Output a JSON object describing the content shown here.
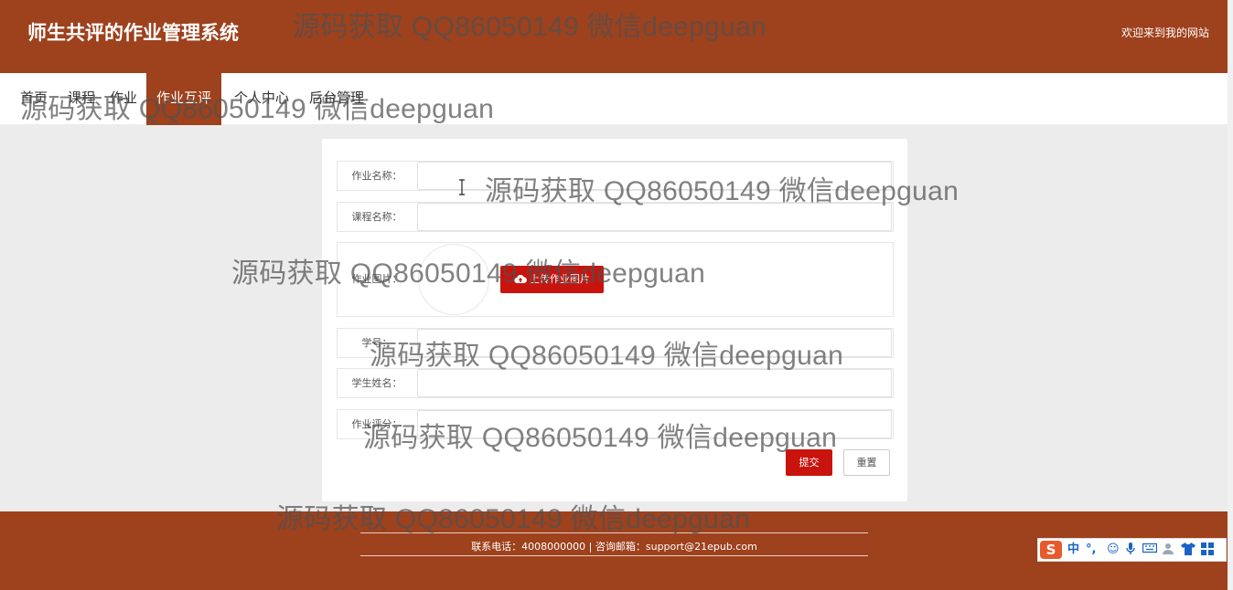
{
  "header": {
    "title": "师生共评的作业管理系统",
    "welcome": "欢迎来到我的网站"
  },
  "nav": {
    "items": [
      {
        "label": "首页"
      },
      {
        "label": "课程"
      },
      {
        "label": "作业"
      },
      {
        "label": "作业互评",
        "active": true
      },
      {
        "label": "个人中心"
      },
      {
        "label": "后台管理"
      }
    ]
  },
  "form": {
    "fields": [
      {
        "label": "作业名称：",
        "value": ""
      },
      {
        "label": "课程名称：",
        "value": ""
      },
      {
        "label": "作业图片：",
        "upload_label": "上传作业图片"
      },
      {
        "label": "学号：",
        "value": ""
      },
      {
        "label": "学生姓名：",
        "value": ""
      },
      {
        "label": "作业评分：",
        "value": ""
      }
    ],
    "submit_label": "提交",
    "reset_label": "重置"
  },
  "footer": {
    "contact": "联系电话：4008000000 | 咨询邮箱：support@21epub.com"
  },
  "watermark": "源码获取 QQ86050149 微信deepguan",
  "ime": {
    "logo": "S",
    "mode": "中"
  },
  "colors": {
    "brand": "#9e411d",
    "accent": "#c9140e",
    "background": "#ececec"
  }
}
